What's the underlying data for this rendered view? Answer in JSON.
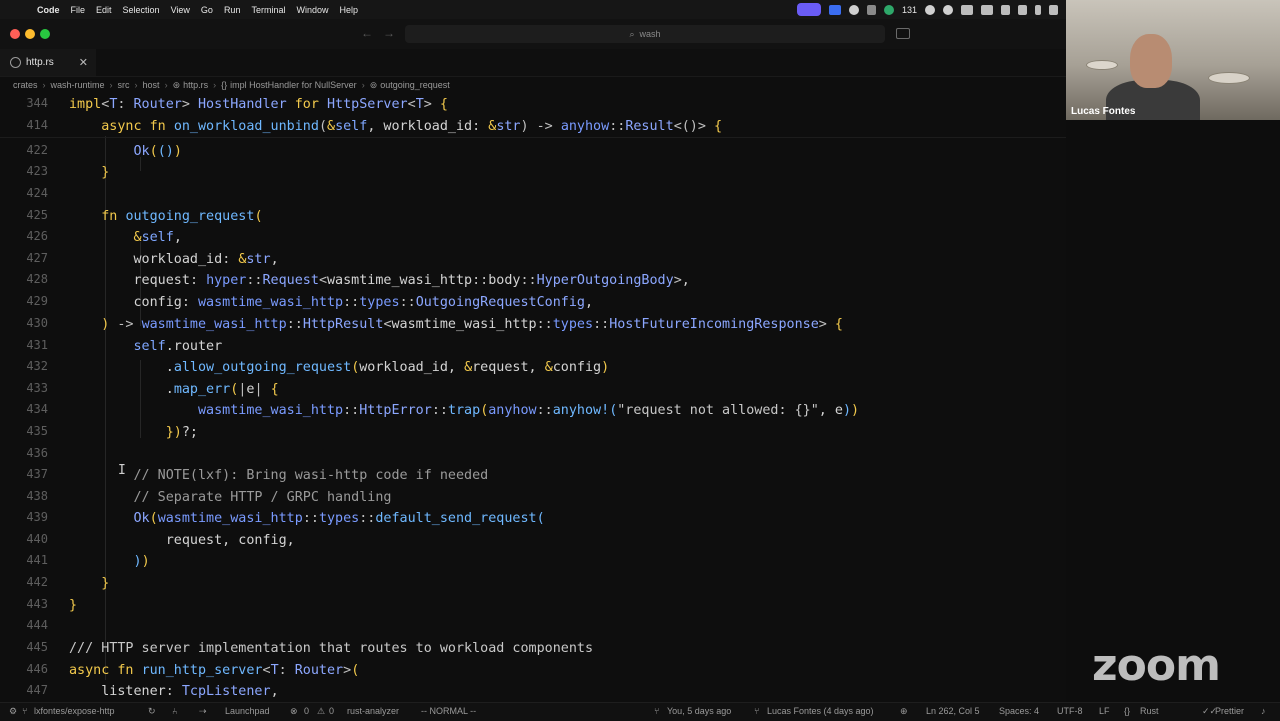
{
  "menubar": {
    "app_name": "Code",
    "menus": [
      "File",
      "Edit",
      "Selection",
      "View",
      "Go",
      "Run",
      "Terminal",
      "Window",
      "Help"
    ],
    "grammarly_count": "131"
  },
  "titlebar": {
    "search_text": "wash"
  },
  "tab": {
    "filename": "http.rs",
    "close_glyph": "✕"
  },
  "breadcrumb": [
    "crates",
    "wash-runtime",
    "src",
    "host",
    "http.rs",
    "impl HostHandler for NullServer",
    "outgoing_request"
  ],
  "editor": {
    "lines": [
      {
        "n": "344",
        "sticky": true
      },
      {
        "n": "414",
        "sticky": true
      },
      {
        "n": "422"
      },
      {
        "n": "423"
      },
      {
        "n": "424"
      },
      {
        "n": "425"
      },
      {
        "n": "426"
      },
      {
        "n": "427"
      },
      {
        "n": "428"
      },
      {
        "n": "429"
      },
      {
        "n": "430"
      },
      {
        "n": "431"
      },
      {
        "n": "432"
      },
      {
        "n": "433"
      },
      {
        "n": "434"
      },
      {
        "n": "435"
      },
      {
        "n": "436"
      },
      {
        "n": "437"
      },
      {
        "n": "438"
      },
      {
        "n": "439"
      },
      {
        "n": "440"
      },
      {
        "n": "441"
      },
      {
        "n": "442"
      },
      {
        "n": "443"
      },
      {
        "n": "444"
      },
      {
        "n": "445"
      },
      {
        "n": "446"
      },
      {
        "n": "447"
      }
    ]
  },
  "zoom": {
    "participant_name": "Lucas Fontes",
    "logo_text": "zoom"
  },
  "statusbar": {
    "branch": "lxfontes/expose-http",
    "launchpad": "Launchpad",
    "errors": "0",
    "warnings": "0",
    "lsp": "rust-analyzer",
    "mode": "-- NORMAL --",
    "blame_self": "You, 5 days ago",
    "blame_author": "Lucas Fontes (4 days ago)",
    "position": "Ln 262, Col 5",
    "indent": "Spaces: 4",
    "encoding": "UTF-8",
    "eol": "LF",
    "language": "Rust",
    "formatter": "Prettier"
  },
  "colors": {
    "keyword": "#f2c94c",
    "type": "#8ca7ff",
    "function": "#6fb8ff",
    "comment": "#9a9a9a",
    "background": "#0e0e0e"
  }
}
